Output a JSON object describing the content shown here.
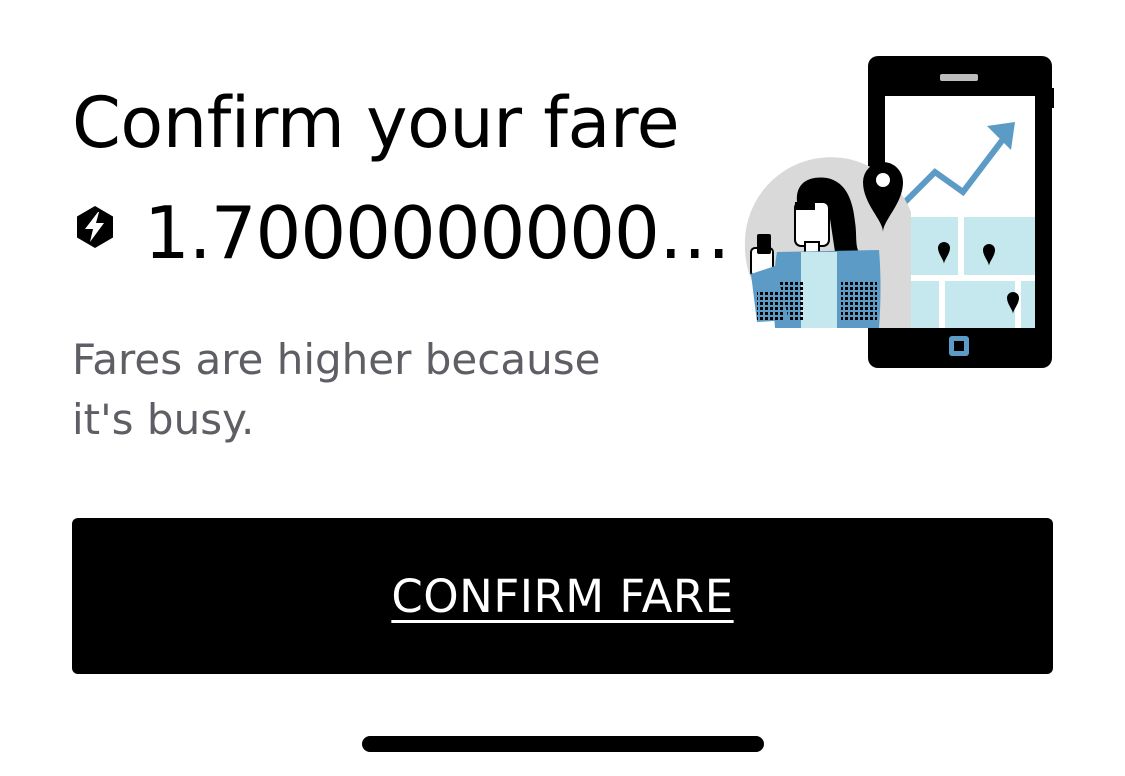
{
  "header": {
    "title": "Confirm your fare"
  },
  "fare": {
    "icon": "surge-lightning-icon",
    "value": "1.7000000000…"
  },
  "message": {
    "text": "Fares are higher because it's busy."
  },
  "illustration": {
    "name": "busy-fare-illustration",
    "colors": {
      "accent_blue": "#5b9bc6",
      "map_fill": "#c5e8ee",
      "circle_gray": "#d9d9d9"
    }
  },
  "actions": {
    "confirm_label": "CONFIRM FARE"
  },
  "colors": {
    "primary": "#000000",
    "secondary_text": "#5e5e64",
    "background": "#ffffff"
  }
}
